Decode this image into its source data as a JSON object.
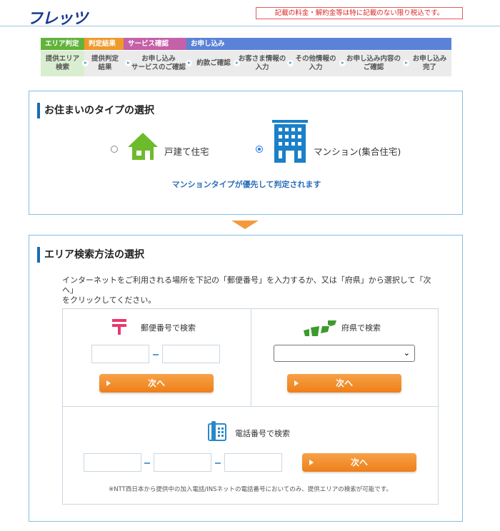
{
  "header": {
    "logo": "フレッツ",
    "notice": "記載の料金・解約金等は特に記載のない限り税込です。"
  },
  "steps": {
    "categories": [
      "エリア判定",
      "判定結果",
      "サービス確認",
      "お申し込み"
    ],
    "items": [
      {
        "line1": "提供エリア",
        "line2": "検索"
      },
      {
        "line1": "提供判定",
        "line2": "結果"
      },
      {
        "line1": "お申し込み",
        "line2": "サービスのご確認"
      },
      {
        "line1": "約款ご確認",
        "line2": ""
      },
      {
        "line1": "お客さま情報の",
        "line2": "入力"
      },
      {
        "line1": "その他情報の",
        "line2": "入力"
      },
      {
        "line1": "お申し込み内容の",
        "line2": "ご確認"
      },
      {
        "line1": "お申し込み",
        "line2": "完了"
      }
    ]
  },
  "residence": {
    "title": "お住まいのタイプの選択",
    "house_label": "戸建て住宅",
    "mansion_label": "マンション(集合住宅)",
    "selected": "mansion",
    "priority_note": "マンションタイプが優先して判定されます"
  },
  "area_search": {
    "title": "エリア検索方法の選択",
    "instruction_line1": "インターネットをご利用される場所を下記の「郵便番号」を入力するか、又は「府県」から選択して「次へ」",
    "instruction_line2": "をクリックしてください。",
    "postal": {
      "label": "郵便番号で検索",
      "field1": "",
      "field2": "",
      "button": "次へ"
    },
    "prefecture": {
      "label": "府県で検索",
      "selected": "",
      "button": "次へ"
    },
    "phone": {
      "label": "電話番号で検索",
      "field1": "",
      "field2": "",
      "field3": "",
      "button": "次へ"
    },
    "note": "※NTT西日本から提供中の加入電話/INSネットの電話番号においてのみ、提供エリアの検索が可能です。"
  },
  "colors": {
    "accent_blue": "#1a6cb4",
    "button_orange": "#ee7f19",
    "area_green": "#62b33b",
    "result_orange": "#ee9a2b",
    "service_pink": "#c561a8",
    "apply_blue": "#5b82d6"
  }
}
